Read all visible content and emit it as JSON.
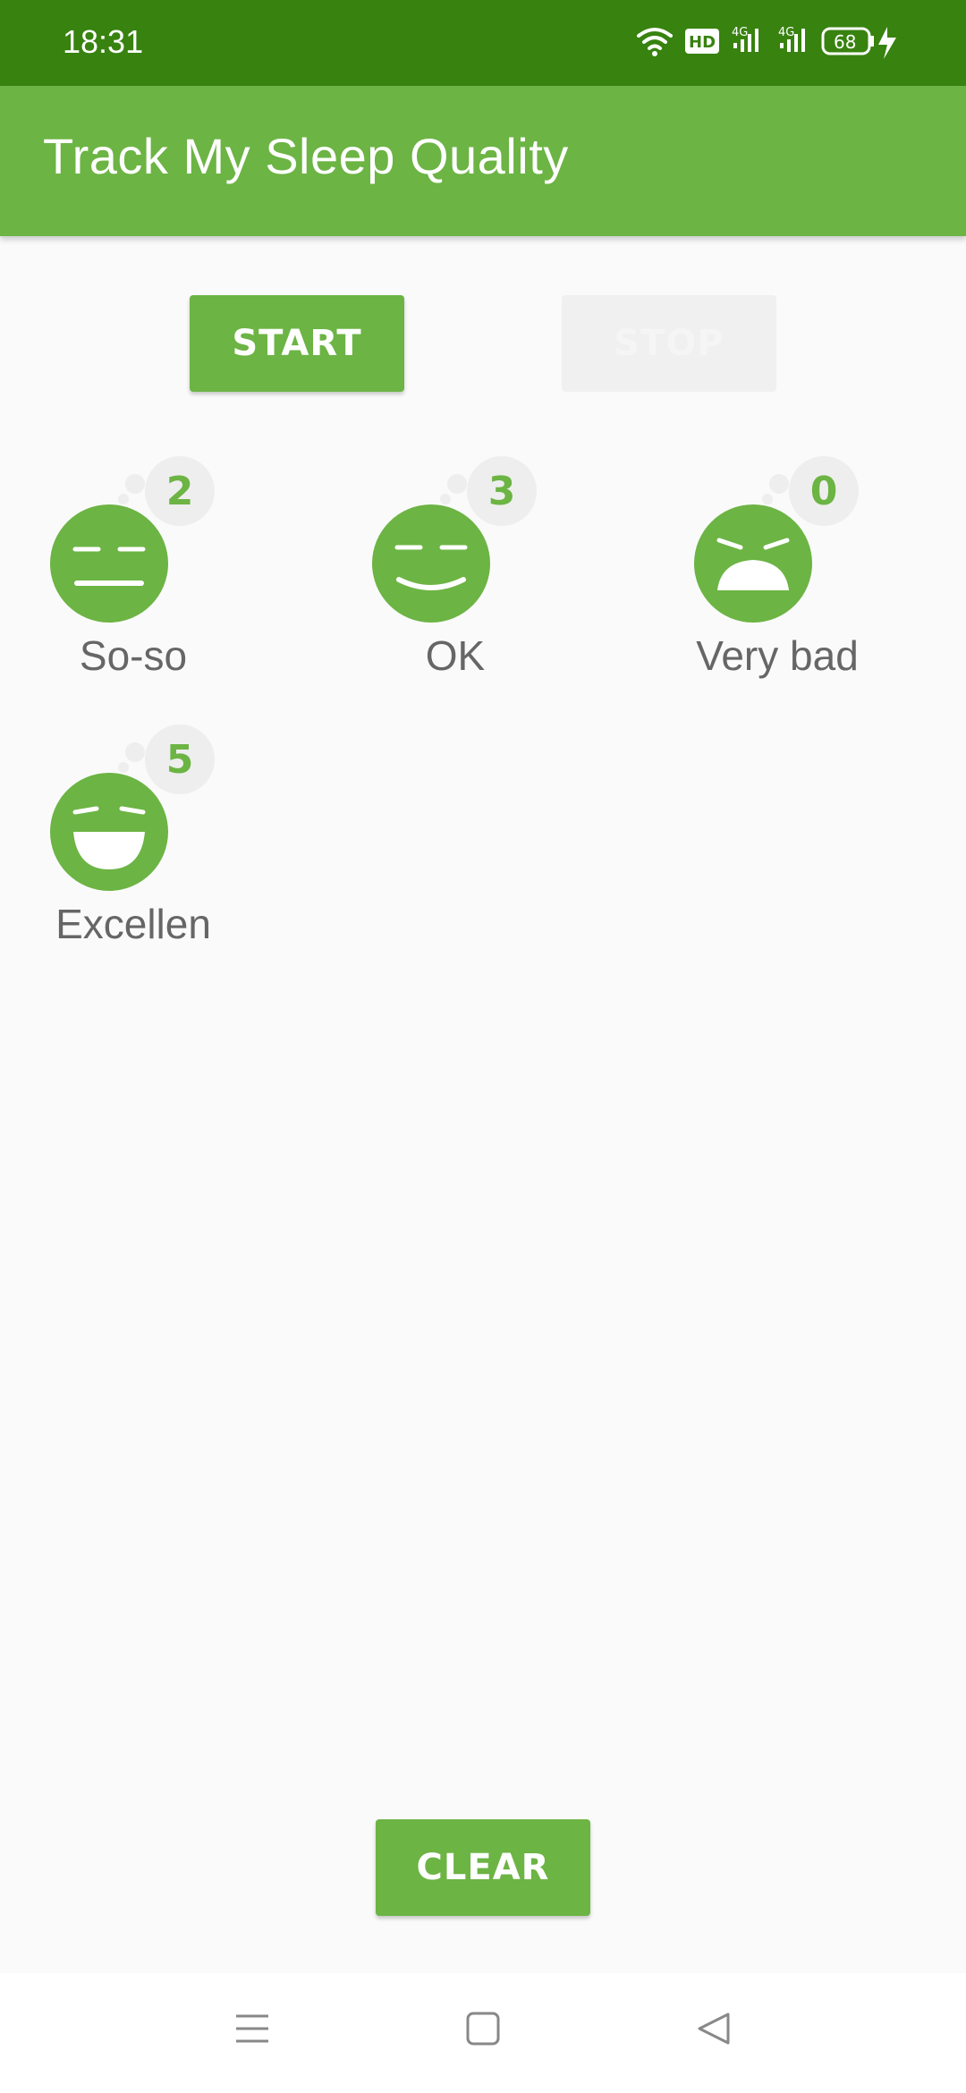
{
  "status_bar": {
    "time": "18:31",
    "battery_level": "68",
    "signal_label_1": "4G",
    "signal_label_2": "4G",
    "hd_label": "HD"
  },
  "app_bar": {
    "title": "Track My Sleep Quality"
  },
  "controls": {
    "start_label": "START",
    "stop_label": "STOP",
    "clear_label": "CLEAR"
  },
  "nights": [
    {
      "label": "So-so",
      "count": "2",
      "face": "so-so-face-icon"
    },
    {
      "label": "OK",
      "count": "3",
      "face": "ok-face-icon"
    },
    {
      "label": "Very bad",
      "count": "0",
      "face": "very-bad-face-icon"
    },
    {
      "label": "Excellen",
      "count": "5",
      "face": "excellent-face-icon"
    }
  ],
  "colors": {
    "primary": "#6cb444",
    "primary_dark": "#388210",
    "background": "#fafafa",
    "label_gray": "#666666"
  }
}
